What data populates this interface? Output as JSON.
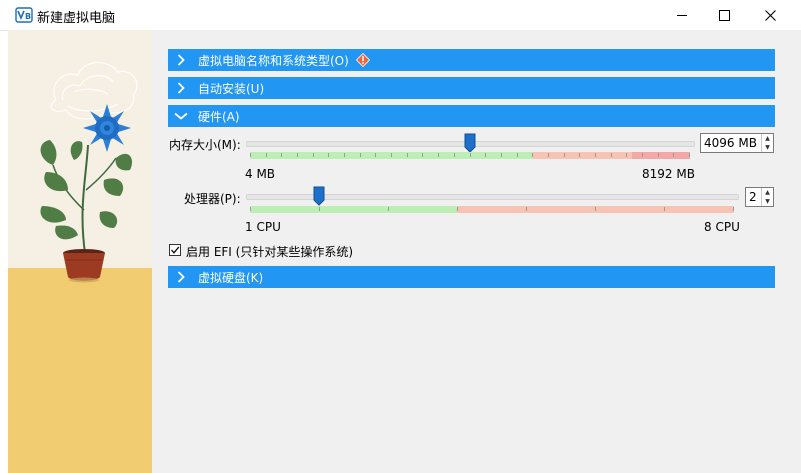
{
  "window": {
    "title": "新建虚拟电脑"
  },
  "sections": {
    "name_os": {
      "label": "虚拟电脑名称和系统类型(O)",
      "expanded": false
    },
    "unattended": {
      "label": "自动安装(U)",
      "expanded": false
    },
    "hardware": {
      "label": "硬件(A)",
      "expanded": true
    },
    "disk": {
      "label": "虚拟硬盘(K)",
      "expanded": false
    }
  },
  "hardware": {
    "memory": {
      "label": "内存大小(M):",
      "value_text": "4096 MB",
      "value": 4096,
      "min": 4,
      "max": 8192,
      "min_label": "4 MB",
      "max_label": "8192 MB"
    },
    "cpu": {
      "label": "处理器(P):",
      "value_text": "2",
      "value": 2,
      "min": 1,
      "max": 8,
      "min_label": "1 CPU",
      "max_label": "8 CPU"
    },
    "efi": {
      "label": "启用 EFI (只针对某些操作系统)",
      "checked": true
    }
  },
  "colors": {
    "header_blue": "#2196f3",
    "scale_green": "#bdeeb5",
    "scale_red": "#f6c3b5",
    "scale_red_dark": "#f3a8a8",
    "handle_blue": "#1e6fc8",
    "floor_yellow": "#f1cc70",
    "warning_orange": "#f0643c"
  },
  "icons": {
    "app": "virtualbox-icon",
    "minimize": "minimize-icon",
    "maximize": "maximize-icon",
    "close": "close-icon",
    "chevron_right": "chevron-right-icon",
    "chevron_down": "chevron-down-icon",
    "warning": "warning-icon"
  }
}
